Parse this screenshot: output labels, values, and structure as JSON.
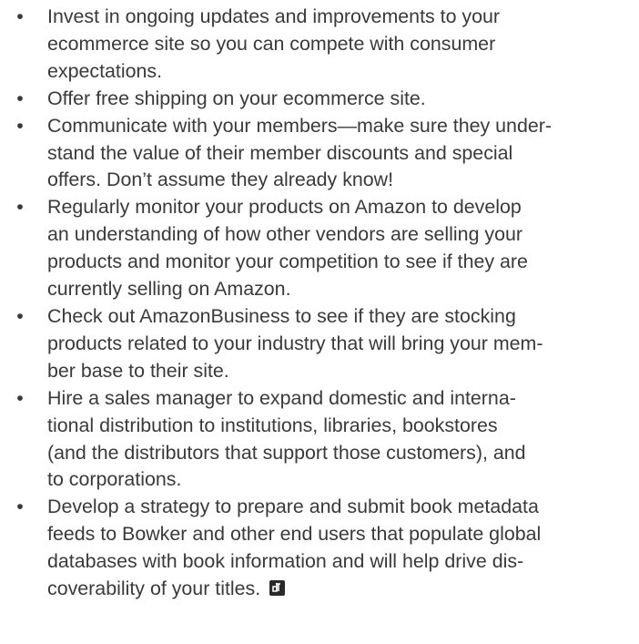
{
  "bullet_char": "•",
  "items": [
    {
      "lines": [
        "Invest in ongoing updates and improvements to your",
        "ecommerce site so you can compete with consumer",
        "expectations."
      ]
    },
    {
      "lines": [
        "Offer free shipping on your ecommerce site."
      ]
    },
    {
      "lines": [
        "Communicate with your members—make sure they under-",
        "stand the value of their member discounts and special",
        "offers. Don’t assume they already know!"
      ]
    },
    {
      "lines": [
        "Regularly monitor your products on Amazon to develop",
        "an understanding of how other vendors are selling your",
        "products and monitor your competition to see if they are",
        "currently selling on Amazon."
      ]
    },
    {
      "lines": [
        "Check out AmazonBusiness to see if they are stocking",
        "products related to your industry that will bring your mem-",
        "ber base to their site."
      ]
    },
    {
      "lines": [
        "Hire a sales manager to expand domestic and interna-",
        "tional distribution to institutions, libraries, bookstores",
        "(and the distributors that support those customers), and",
        "to corporations."
      ]
    },
    {
      "lines": [
        "Develop a strategy to prepare and submit book metadata",
        "feeds to Bowker and other end users that populate global",
        "databases with book information and will help drive dis-",
        "coverability of your titles."
      ]
    }
  ],
  "end_mark": {
    "icon": "article-end-mark-icon",
    "color": "#2a2a2a"
  }
}
